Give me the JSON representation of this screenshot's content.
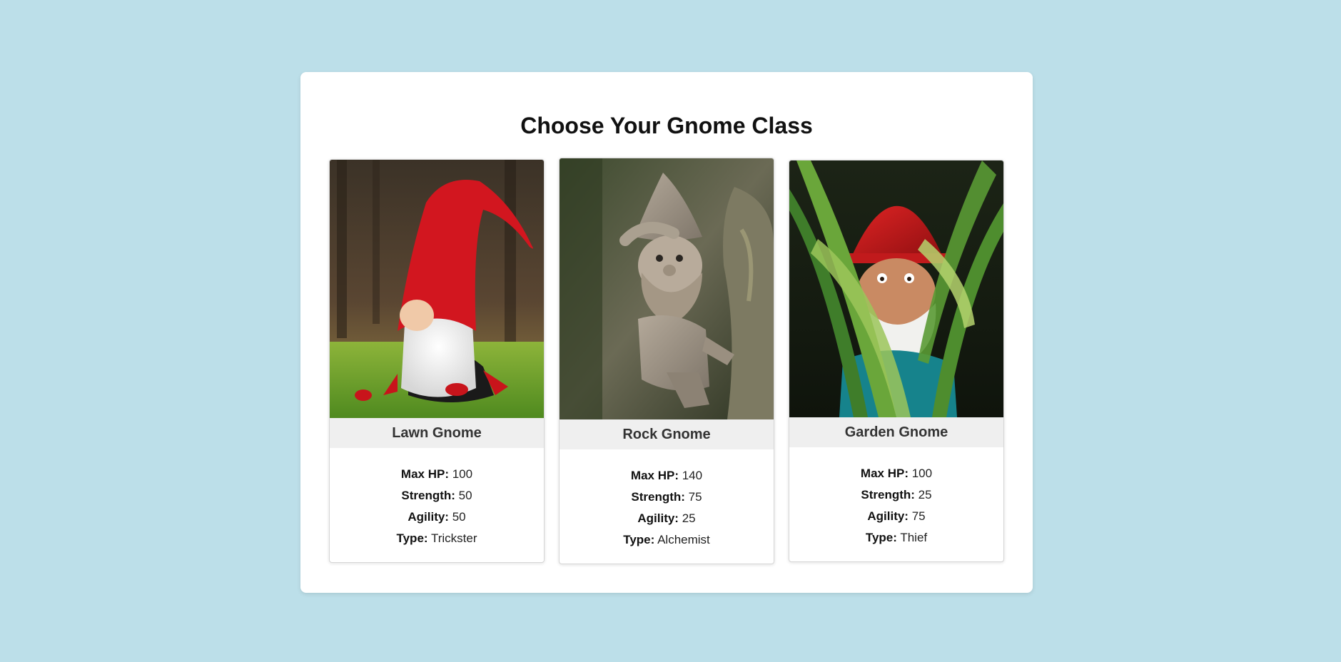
{
  "page": {
    "title": "Choose Your Gnome Class",
    "background": "#bcdfe9"
  },
  "gnomes": [
    {
      "name": "Lawn Gnome",
      "image": "lawn-gnome-photo",
      "max_hp_label": "Max HP:",
      "max_hp": "100",
      "strength_label": "Strength:",
      "strength": "50",
      "agility_label": "Agility:",
      "agility": "50",
      "type_label": "Type:",
      "type": "Trickster"
    },
    {
      "name": "Rock Gnome",
      "image": "rock-gnome-photo",
      "max_hp_label": "Max HP:",
      "max_hp": "140",
      "strength_label": "Strength:",
      "strength": "75",
      "agility_label": "Agility:",
      "agility": "25",
      "type_label": "Type:",
      "type": "Alchemist"
    },
    {
      "name": "Garden Gnome",
      "image": "garden-gnome-photo",
      "max_hp_label": "Max HP:",
      "max_hp": "100",
      "strength_label": "Strength:",
      "strength": "25",
      "agility_label": "Agility:",
      "agility": "75",
      "type_label": "Type:",
      "type": "Thief"
    }
  ]
}
